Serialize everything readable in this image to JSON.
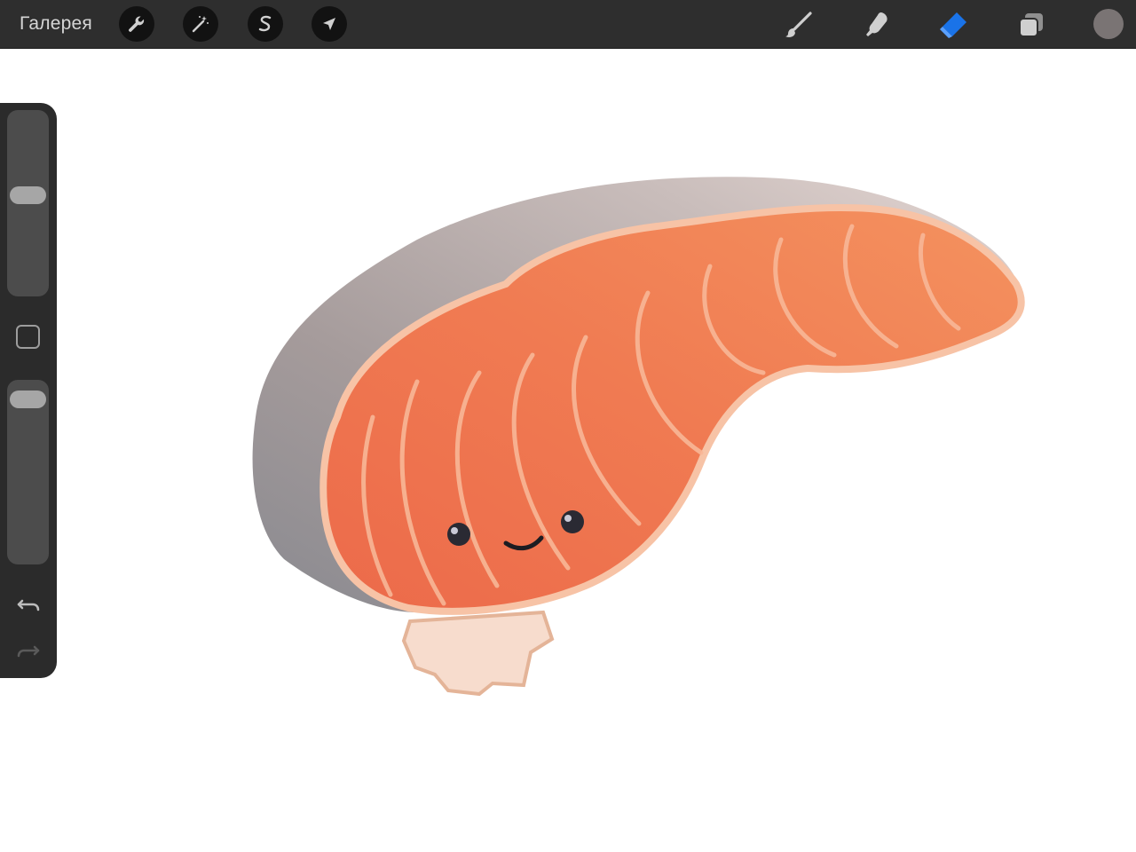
{
  "topbar": {
    "gallery_label": "Галерея",
    "left_tools": [
      {
        "name": "actions",
        "icon": "wrench-icon"
      },
      {
        "name": "adjustments",
        "icon": "magic-wand-icon"
      },
      {
        "name": "selection",
        "icon": "selection-s-icon"
      },
      {
        "name": "transform",
        "icon": "arrow-cursor-icon"
      }
    ],
    "right_tools": [
      {
        "name": "brush",
        "icon": "brush-icon"
      },
      {
        "name": "smudge",
        "icon": "smudge-finger-icon"
      },
      {
        "name": "eraser",
        "icon": "eraser-icon",
        "active": true
      },
      {
        "name": "layers",
        "icon": "layers-icon"
      }
    ],
    "current_color": "#7a7474",
    "active_tool_color": "#1a73e8"
  },
  "sidebar": {
    "brush_size_level": 0.55,
    "opacity_level": 0.95,
    "modifier_icon": "square-icon",
    "undo_icon": "undo-icon",
    "redo_icon": "redo-icon",
    "redo_enabled": false
  },
  "canvas": {
    "background": "#ffffff",
    "artwork": "salmon-sushi-drawing"
  }
}
